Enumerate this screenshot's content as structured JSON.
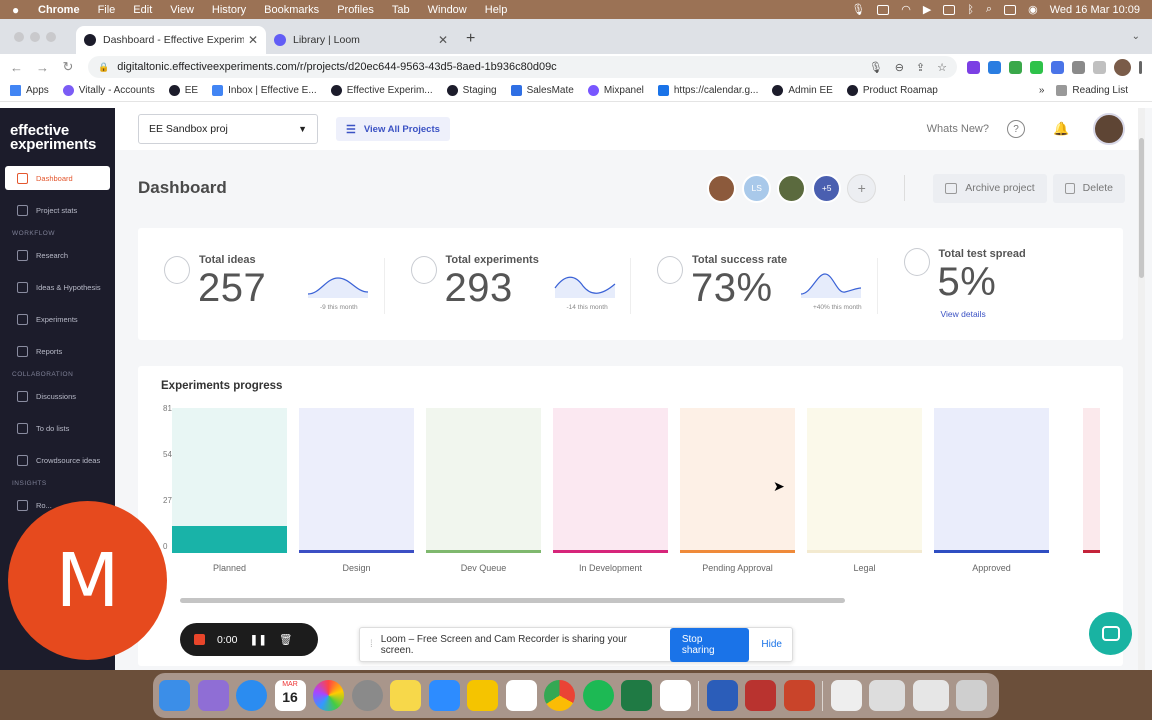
{
  "menubar": {
    "app": "Chrome",
    "items": [
      "File",
      "Edit",
      "View",
      "History",
      "Bookmarks",
      "Profiles",
      "Tab",
      "Window",
      "Help"
    ],
    "clock": "Wed 16 Mar  10:09"
  },
  "browser": {
    "tabs": [
      {
        "title": "Dashboard - Effective Experim",
        "active": true,
        "favicon_color": "#1c1c2b"
      },
      {
        "title": "Library | Loom",
        "active": false,
        "favicon_color": "#625df5"
      }
    ],
    "url": "digitaltonic.effectiveexperiments.com/r/projects/d20ec644-9563-43d5-8aed-1b936c80d09c",
    "bookmarks": [
      {
        "label": "Apps",
        "color": "#4285f4"
      },
      {
        "label": "Vitally - Accounts",
        "color": "#7b5cf5"
      },
      {
        "label": "EE",
        "color": "#1c1c2b"
      },
      {
        "label": "Inbox | Effective E...",
        "color": "#4285f4"
      },
      {
        "label": "Effective Experim...",
        "color": "#1c1c2b"
      },
      {
        "label": "Staging",
        "color": "#1c1c2b"
      },
      {
        "label": "SalesMate",
        "color": "#2f6fe4"
      },
      {
        "label": "Mixpanel",
        "color": "#7856ff"
      },
      {
        "label": "https://calendar.g...",
        "color": "#1a73e8"
      },
      {
        "label": "Admin EE",
        "color": "#1c1c2b"
      },
      {
        "label": "Product Roamap",
        "color": "#1c1c2b"
      }
    ],
    "more": "»",
    "reading_list": "Reading List"
  },
  "app": {
    "logo": "effective experiments",
    "sidebar": {
      "items": [
        {
          "label": "Dashboard",
          "active": true
        },
        {
          "label": "Project stats"
        }
      ],
      "workflow_heading": "WORKFLOW",
      "workflow": [
        {
          "label": "Research"
        },
        {
          "label": "Ideas & Hypothesis"
        },
        {
          "label": "Experiments"
        },
        {
          "label": "Reports"
        }
      ],
      "collab_heading": "COLLABORATION",
      "collab": [
        {
          "label": "Discussions"
        },
        {
          "label": "To do lists"
        },
        {
          "label": "Crowdsource ideas"
        }
      ],
      "insights_heading": "INSIGHTS",
      "insights": [
        {
          "label": "Ro..."
        }
      ]
    },
    "topbar": {
      "project": "EE Sandbox proj",
      "view_all": "View All Projects",
      "whats_new": "Whats New?",
      "help": "?"
    },
    "title": "Dashboard",
    "members": {
      "initials": "LS",
      "more": "+5",
      "add": "+"
    },
    "archive": "Archive project",
    "delete": "Delete",
    "stats": [
      {
        "label": "Total ideas",
        "value": "257",
        "delta": "-9 this month"
      },
      {
        "label": "Total experiments",
        "value": "293",
        "delta": "-14 this month"
      },
      {
        "label": "Total success rate",
        "value": "73%",
        "delta": "+40% this month"
      },
      {
        "label": "Total test spread",
        "value": "5%",
        "link": "View details"
      }
    ],
    "progress": {
      "title": "Experiments progress",
      "yticks": [
        "81",
        "54",
        "27",
        "0"
      ]
    }
  },
  "chart_data": {
    "type": "bar",
    "title": "Experiments progress",
    "categories": [
      "Planned",
      "Design",
      "Dev Queue",
      "In Development",
      "Pending Approval",
      "Legal",
      "Approved"
    ],
    "values": [
      15,
      0,
      0,
      0,
      0,
      0,
      0
    ],
    "ylim": [
      0,
      81
    ],
    "yticks": [
      0,
      27,
      54,
      81
    ],
    "colors": [
      "#19b3a8",
      "#3c4fc4",
      "#7fb86e",
      "#d6257a",
      "#ef8a3a",
      "#f3ead0",
      "#2f4ec2"
    ]
  },
  "loom": {
    "cam_letter": "M",
    "timer": "0:00",
    "share_text": "Loom – Free Screen and Cam Recorder is sharing your screen.",
    "stop_sharing": "Stop sharing",
    "hide": "Hide"
  },
  "dock": {
    "calendar_month": "MAR",
    "calendar_day": "16"
  }
}
